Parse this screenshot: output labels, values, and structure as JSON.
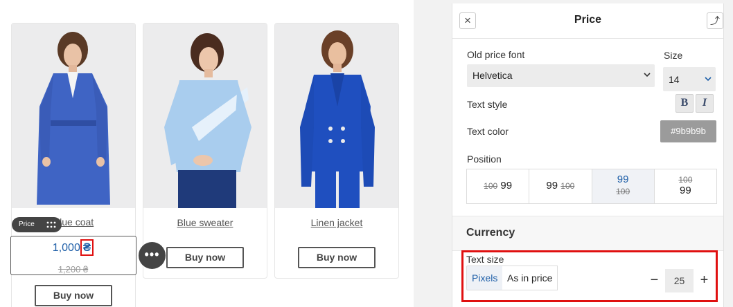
{
  "products": [
    {
      "name": "Blue coat",
      "button": "Buy now"
    },
    {
      "name": "Blue sweater",
      "button": "Buy now"
    },
    {
      "name": "Linen jacket",
      "button": "Buy now"
    }
  ],
  "price": {
    "new": "1,000",
    "currency_symbol": "₴",
    "old": "1,200 ₴"
  },
  "price_tag": {
    "label": "Price"
  },
  "more_button": {
    "label": "•••"
  },
  "panel": {
    "title": "Price",
    "close_icon": "×",
    "back_icon": "⤴",
    "old_price_font_label": "Old price font",
    "font_value": "Helvetica",
    "size_label": "Size",
    "size_value": "14",
    "text_style_label": "Text style",
    "bold_label": "B",
    "italic_label": "I",
    "text_color_label": "Text color",
    "text_color_value": "#9b9b9b",
    "position_label": "Position",
    "position_options": [
      {
        "old": "100",
        "new": "99"
      },
      {
        "old": "100",
        "new": "99"
      },
      {
        "old": "100",
        "new": "99"
      },
      {
        "old": "100",
        "new": "99"
      }
    ],
    "currency_title": "Currency",
    "text_size_label": "Text size",
    "unit_pixels": "Pixels",
    "unit_as_in_price": "As in price",
    "minus": "−",
    "plus": "+",
    "text_size_value": "25"
  },
  "colors": {
    "accent": "#1f5fa8",
    "highlight": "#e01010",
    "swatch": "#9b9b9b"
  }
}
